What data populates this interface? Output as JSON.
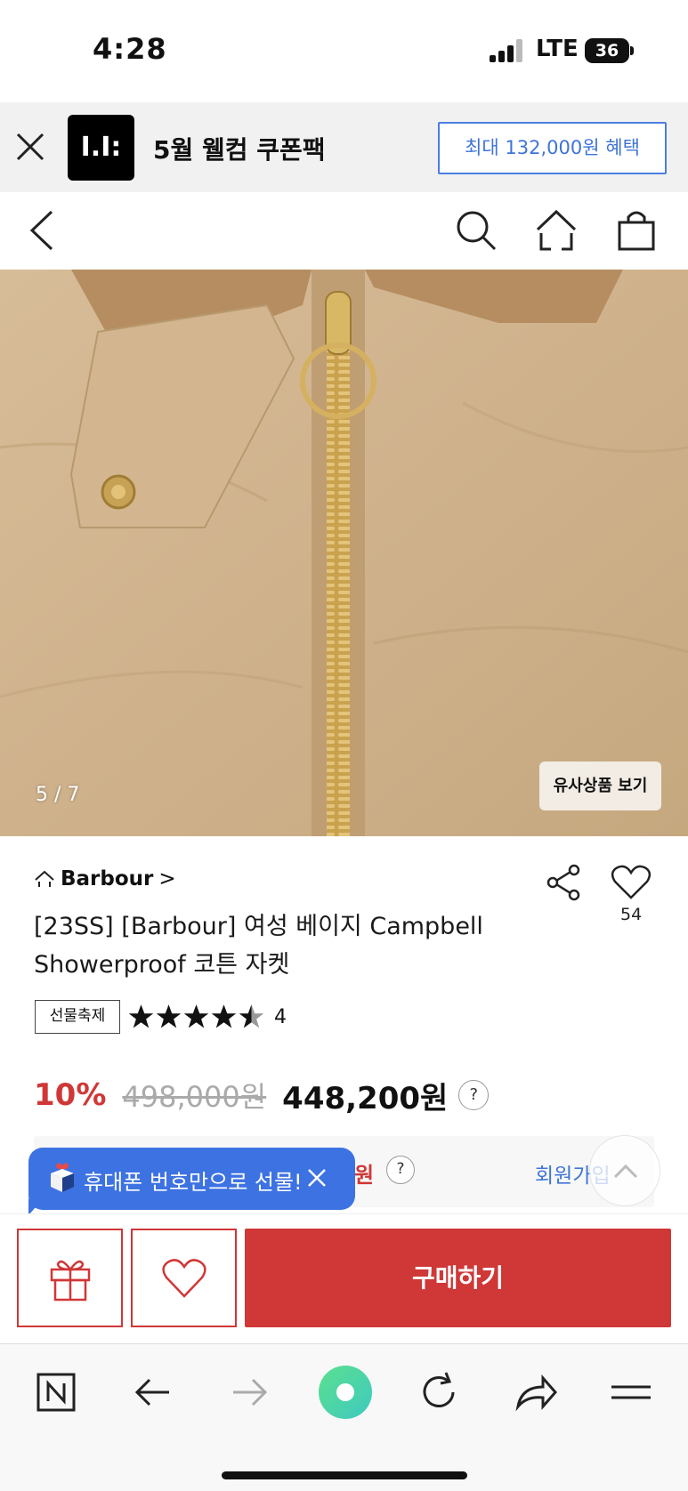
{
  "status_bar": {
    "time": "4:28",
    "network": "LTE",
    "battery": "36"
  },
  "coupon_banner": {
    "logo_text": "I.I:",
    "title": "5월 웰컴 쿠폰팩",
    "cta": "최대 132,000원 혜택"
  },
  "gallery": {
    "counter": "5 / 7",
    "similar_button": "유사상품 보기"
  },
  "product": {
    "brand": "Barbour",
    "brand_chevron": ">",
    "title": "[23SS] [Barbour] 여성 베이지 Campbell Showerproof 코튼 자켓",
    "likes": "54",
    "badge": "선물축제",
    "rating_value": 4.5,
    "review_count": "4",
    "discount": "10%",
    "original_price": "498,000원",
    "final_price": "448,200원",
    "help": "?"
  },
  "member_row": {
    "amount_suffix": "원",
    "help": "?",
    "join": "회원가입"
  },
  "tooltip": {
    "text": "휴대폰 번호만으로 선물!"
  },
  "purchase_bar": {
    "buy_label": "구매하기"
  },
  "colors": {
    "accent_red": "#d03737",
    "link_blue": "#3f74d8",
    "tooltip_blue": "#3d72e2"
  },
  "icons": [
    "close-icon",
    "back-icon",
    "search-icon",
    "home-icon",
    "cart-icon",
    "share-icon",
    "heart-icon",
    "gift-icon",
    "star-icon",
    "chevron-up-icon",
    "naver-icon",
    "arrow-left-icon",
    "arrow-right-icon",
    "green-dot-icon",
    "refresh-icon",
    "forward-share-icon",
    "menu-icon"
  ]
}
